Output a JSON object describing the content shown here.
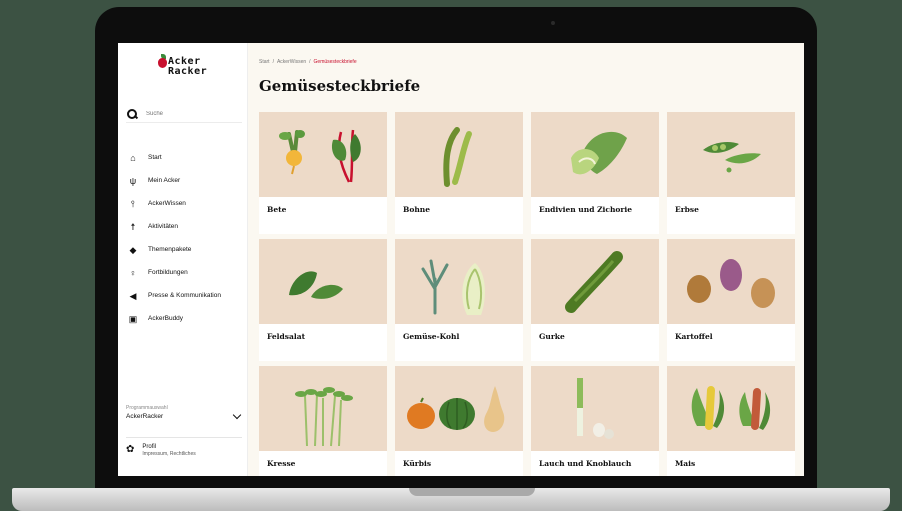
{
  "app": {
    "logo_line1": "Acker",
    "logo_line2": "Racker"
  },
  "search": {
    "placeholder": "Suche"
  },
  "nav": {
    "items": [
      {
        "label": "Start",
        "icon": "home-icon"
      },
      {
        "label": "Mein Acker",
        "icon": "sprout-icon"
      },
      {
        "label": "AckerWissen",
        "icon": "shovel-icon"
      },
      {
        "label": "Aktivitäten",
        "icon": "person-icon"
      },
      {
        "label": "Themenpakete",
        "icon": "bird-icon"
      },
      {
        "label": "Fortbildungen",
        "icon": "teacher-icon"
      },
      {
        "label": "Presse & Kommunikation",
        "icon": "megaphone-icon"
      },
      {
        "label": "AckerBuddy",
        "icon": "book-icon"
      }
    ]
  },
  "program_switcher": {
    "label": "Programmauswahl",
    "value": "AckerRacker"
  },
  "profile": {
    "title": "Profil",
    "subtitle": "Impressum, Rechtliches"
  },
  "breadcrumb": {
    "items": [
      "Start",
      "AckerWissen",
      "Gemüsesteckbriefe"
    ]
  },
  "page": {
    "title": "Gemüsesteckbriefe"
  },
  "cards": [
    {
      "label": "Bete",
      "image": "beet-illustration"
    },
    {
      "label": "Bohne",
      "image": "bean-illustration"
    },
    {
      "label": "Endivien und Zichorie",
      "image": "lettuce-illustration"
    },
    {
      "label": "Erbse",
      "image": "pea-illustration"
    },
    {
      "label": "Feldsalat",
      "image": "lamb-lettuce-illustration"
    },
    {
      "label": "Gemüse-Kohl",
      "image": "cabbage-illustration"
    },
    {
      "label": "Gurke",
      "image": "cucumber-illustration"
    },
    {
      "label": "Kartoffel",
      "image": "potato-illustration"
    },
    {
      "label": "Kresse",
      "image": "cress-illustration"
    },
    {
      "label": "Kürbis",
      "image": "pumpkin-illustration"
    },
    {
      "label": "Lauch und Knoblauch",
      "image": "leek-illustration"
    },
    {
      "label": "Mais",
      "image": "corn-illustration"
    }
  ],
  "colors": {
    "background": "#3c5243",
    "accent": "#c8102e",
    "card_image_bg": "#eddac8",
    "page_bg": "#fbf8f1"
  }
}
